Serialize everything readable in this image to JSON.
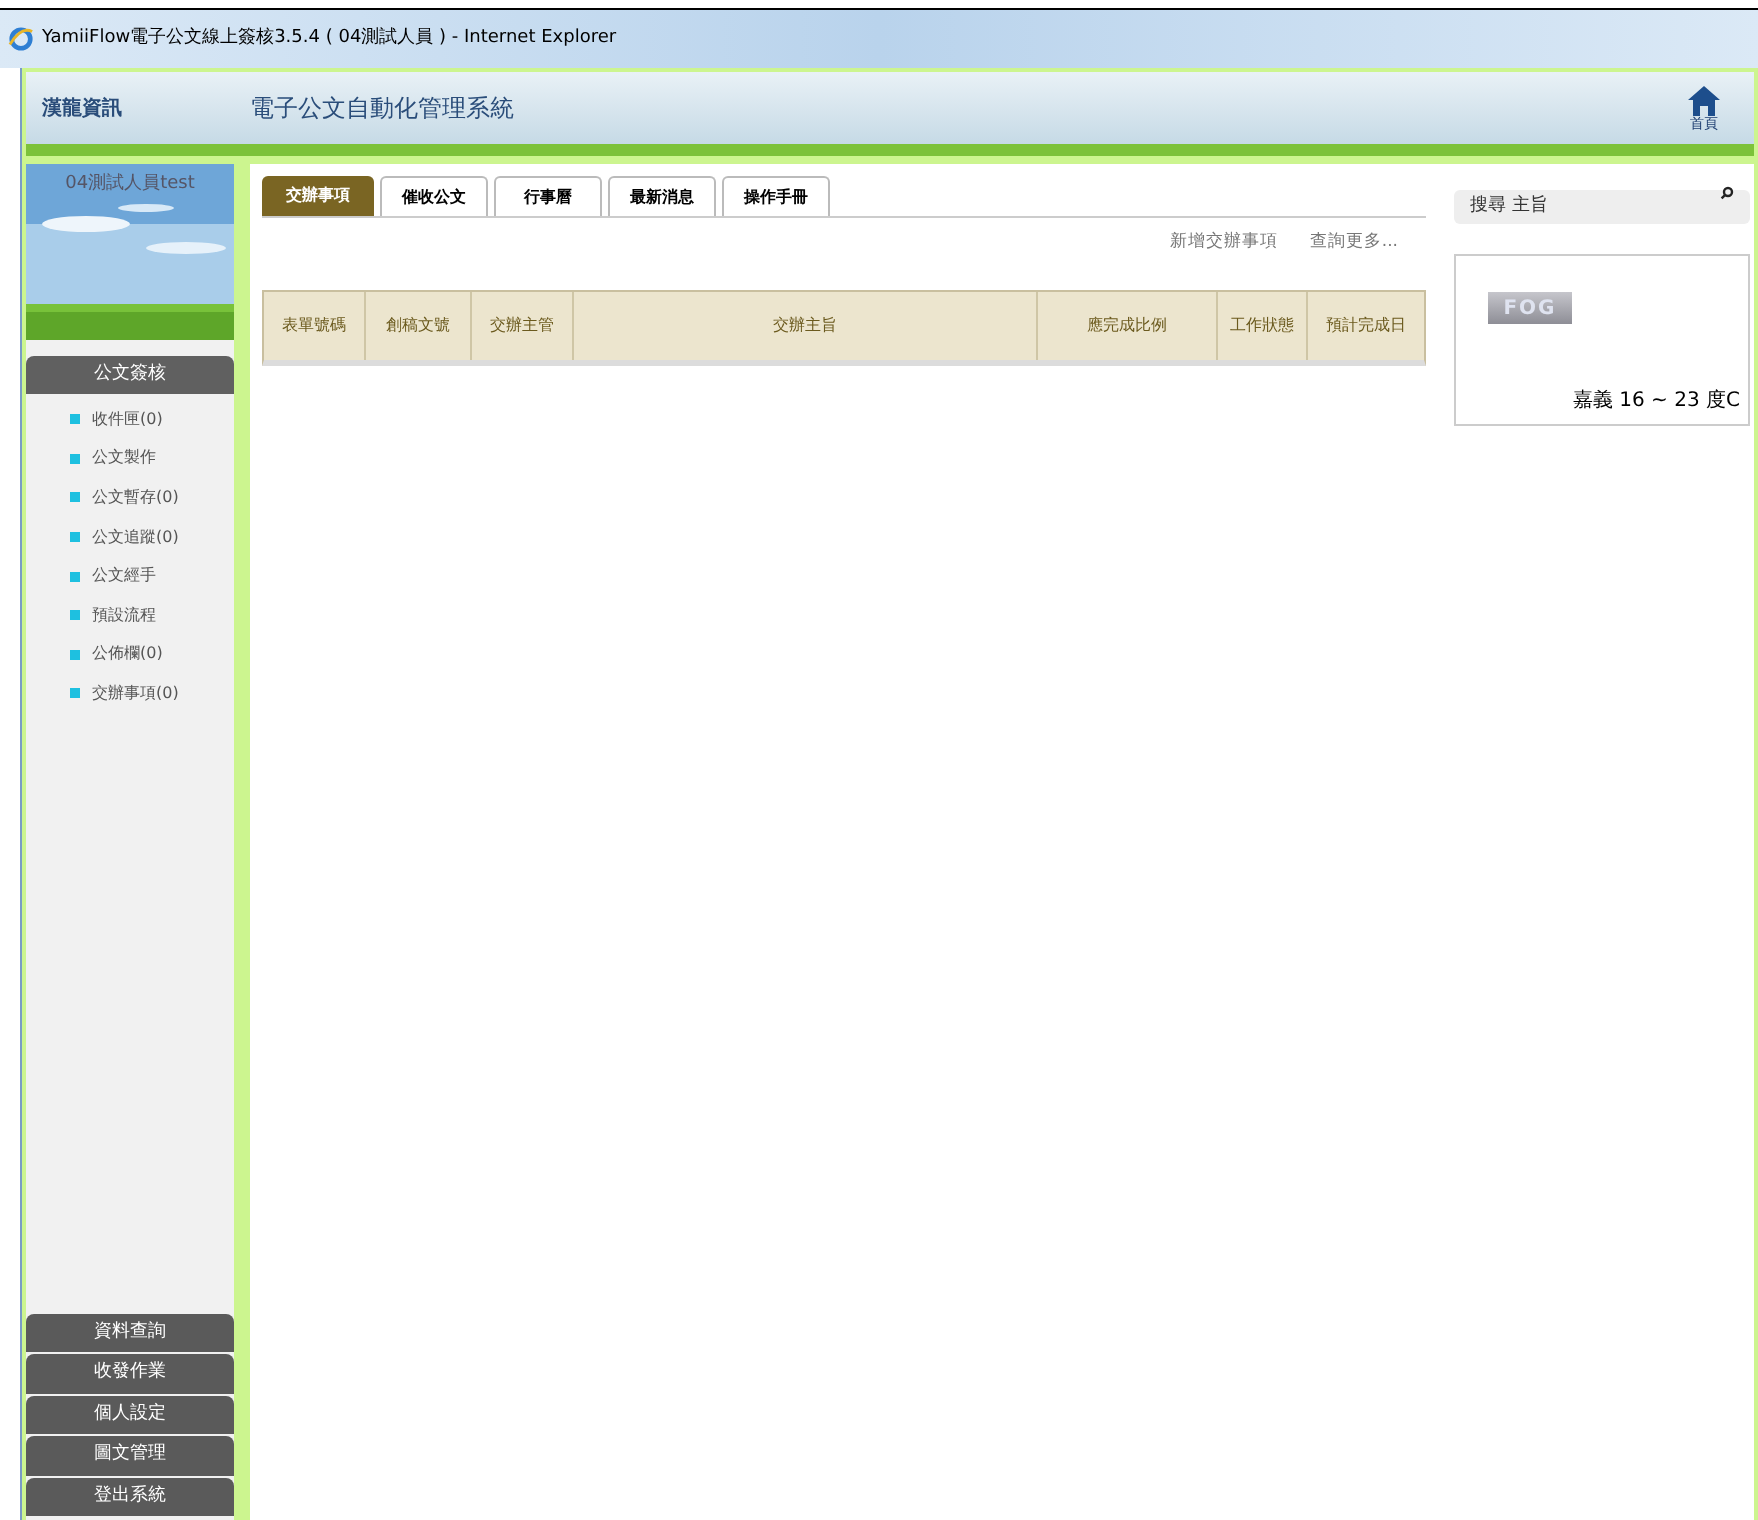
{
  "window": {
    "title": "YamiiFlow電子公文線上簽核3.5.4 ( 04測試人員 ) - Internet Explorer"
  },
  "header": {
    "company": "漢龍資訊",
    "system_title": "電子公文自動化管理系統",
    "home_label": "首頁"
  },
  "sidebar": {
    "user_name": "04測試人員test",
    "section_title": "公文簽核",
    "items": [
      {
        "label": "收件匣(0)"
      },
      {
        "label": "公文製作"
      },
      {
        "label": "公文暫存(0)"
      },
      {
        "label": "公文追蹤(0)"
      },
      {
        "label": "公文經手"
      },
      {
        "label": "預設流程"
      },
      {
        "label": "公佈欄(0)"
      },
      {
        "label": "交辦事項(0)"
      }
    ],
    "bottom_buttons": [
      "資料查詢",
      "收發作業",
      "個人設定",
      "圖文管理",
      "登出系統"
    ]
  },
  "tabs": [
    {
      "label": "交辦事項",
      "selected": true
    },
    {
      "label": "催收公文",
      "selected": false
    },
    {
      "label": "行事曆",
      "selected": false
    },
    {
      "label": "最新消息",
      "selected": false
    },
    {
      "label": "操作手冊",
      "selected": false
    }
  ],
  "actions": [
    "新增交辦事項",
    "查詢更多..."
  ],
  "table": {
    "columns": [
      "表單號碼",
      "創稿文號",
      "交辦主管",
      "交辦主旨",
      "應完成比例",
      "工作狀態",
      "預計完成日"
    ]
  },
  "search": {
    "placeholder": "搜尋 主旨"
  },
  "weather": {
    "icon_label": "FOG",
    "text": "嘉義 16 ~ 23 度C"
  }
}
